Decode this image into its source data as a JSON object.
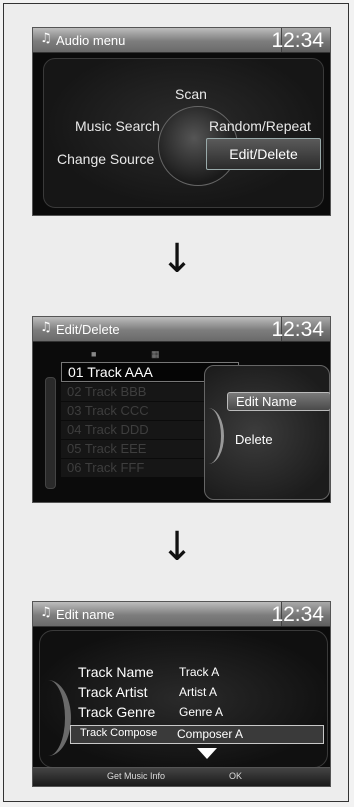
{
  "screen1": {
    "title": "Audio menu",
    "clock": "12:34",
    "items": {
      "scan": "Scan",
      "music_search": "Music Search",
      "random_repeat": "Random/Repeat",
      "change_source": "Change Source",
      "edit_delete": "Edit/Delete"
    }
  },
  "arrow": "↓",
  "screen2": {
    "title": "Edit/Delete",
    "clock": "12:34",
    "tracks": [
      "01 Track AAA",
      "02 Track BBB",
      "03 Track CCC",
      "04 Track DDD",
      "05 Track EEE",
      "06 Track FFF"
    ],
    "options": [
      "Edit Name",
      "Delete"
    ]
  },
  "screen3": {
    "title": "Edit name",
    "clock": "12:34",
    "fields": [
      {
        "label": "Track Name",
        "value": "Track A"
      },
      {
        "label": "Track Artist",
        "value": "Artist A"
      },
      {
        "label": "Track Genre",
        "value": "Genre A"
      },
      {
        "label": "Track Compose",
        "value": "Composer A"
      }
    ],
    "footer": {
      "left": "Get Music Info",
      "right": "OK"
    }
  },
  "icons": {
    "title_icon": "music-note-icon",
    "scroll_down": "triangle-down-icon"
  }
}
